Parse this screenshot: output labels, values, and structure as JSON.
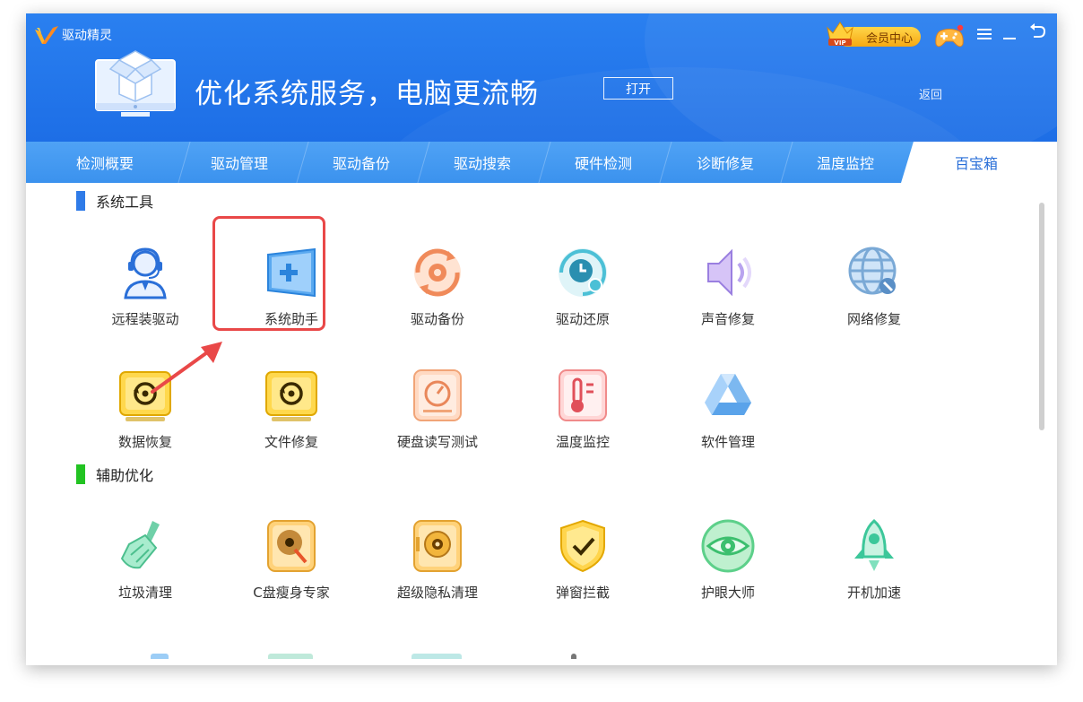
{
  "app": {
    "title": "驱动精灵"
  },
  "banner": {
    "headline": "优化系统服务，电脑更流畅",
    "open_button": "打开",
    "back_link": "返回"
  },
  "vip": {
    "badge": "VIP",
    "label": "会员中心"
  },
  "tabs": [
    {
      "label": "检测概要"
    },
    {
      "label": "驱动管理"
    },
    {
      "label": "驱动备份"
    },
    {
      "label": "驱动搜索"
    },
    {
      "label": "硬件检测"
    },
    {
      "label": "诊断修复"
    },
    {
      "label": "温度监控"
    },
    {
      "label": "百宝箱"
    }
  ],
  "active_tab": "百宝箱",
  "sections": [
    {
      "title": "系统工具",
      "color": "#2f7be8",
      "tools": [
        {
          "label": "远程装驱动",
          "icon": "remote-headset-icon"
        },
        {
          "label": "系统助手",
          "icon": "windows-plus-icon"
        },
        {
          "label": "驱动备份",
          "icon": "backup-gear-icon"
        },
        {
          "label": "驱动还原",
          "icon": "restore-clock-icon"
        },
        {
          "label": "声音修复",
          "icon": "speaker-icon"
        },
        {
          "label": "网络修复",
          "icon": "globe-wrench-icon"
        },
        {
          "label": "数据恢复",
          "icon": "data-recovery-icon"
        },
        {
          "label": "文件修复",
          "icon": "file-repair-icon"
        },
        {
          "label": "硬盘读写测试",
          "icon": "disk-gauge-icon"
        },
        {
          "label": "温度监控",
          "icon": "thermometer-icon"
        },
        {
          "label": "软件管理",
          "icon": "software-triangle-icon"
        }
      ]
    },
    {
      "title": "辅助优化",
      "color": "#22c322",
      "tools": [
        {
          "label": "垃圾清理",
          "icon": "broom-icon"
        },
        {
          "label": "C盘瘦身专家",
          "icon": "disk-slim-icon"
        },
        {
          "label": "超级隐私清理",
          "icon": "privacy-safe-icon"
        },
        {
          "label": "弹窗拦截",
          "icon": "popup-shield-icon"
        },
        {
          "label": "护眼大师",
          "icon": "eye-care-icon"
        },
        {
          "label": "开机加速",
          "icon": "rocket-icon"
        }
      ]
    }
  ],
  "colors": {
    "banner": "#1d6ee6",
    "tabbar": "#3b92ee",
    "highlight": "#e94848"
  }
}
